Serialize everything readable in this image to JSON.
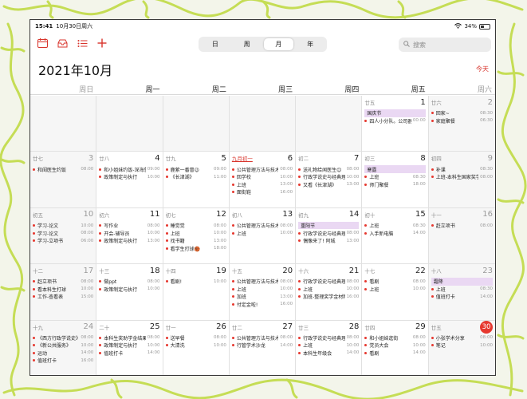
{
  "status": {
    "time": "15:41",
    "date": "10月30日周六",
    "battery": "34%"
  },
  "toolbar": {
    "views": [
      "日",
      "周",
      "月",
      "年"
    ],
    "active_view": "月",
    "search_placeholder": "搜索"
  },
  "title": {
    "year_month": "2021年10月",
    "today": "今天"
  },
  "weekdays": [
    "周日",
    "周一",
    "周二",
    "周三",
    "周四",
    "周五",
    "周六"
  ],
  "colors": {
    "accent": "#e6382f",
    "holiday_bg": "#ead8f3"
  },
  "weeks": [
    [
      {
        "blank": true,
        "lunar": "",
        "day": "",
        "events": []
      },
      {
        "blank": true,
        "lunar": "",
        "day": "",
        "events": []
      },
      {
        "blank": true,
        "lunar": "",
        "day": "",
        "events": []
      },
      {
        "blank": true,
        "lunar": "",
        "day": "",
        "events": []
      },
      {
        "blank": true,
        "lunar": "",
        "day": "",
        "events": []
      },
      {
        "lunar": "廿五",
        "day": "1",
        "events": [
          {
            "title": "国庆节",
            "holiday": true
          },
          {
            "title": "四人小分队。公司器...",
            "time": "00:00"
          }
        ]
      },
      {
        "lunar": "廿六",
        "day": "2",
        "events": [
          {
            "title": "回家~",
            "time": "08:30"
          },
          {
            "title": "家庭聚餐",
            "time": "06:30"
          }
        ]
      }
    ],
    [
      {
        "lunar": "廿七",
        "day": "3",
        "events": [
          {
            "title": "和闺医生约饭",
            "time": "08:00"
          }
        ]
      },
      {
        "lunar": "廿八",
        "day": "4",
        "events": [
          {
            "title": "和小姐妹约饭-深海鲁...",
            "time": "09:00"
          },
          {
            "title": "政策制定与执行",
            "time": "10:00"
          }
        ]
      },
      {
        "lunar": "廿九",
        "day": "5",
        "events": [
          {
            "title": "鹿萦一番冒😉",
            "time": "09:00"
          },
          {
            "title": "《长津湖》",
            "time": "11:00"
          }
        ]
      },
      {
        "lunar": "九月初一",
        "lunar_red": true,
        "day": "6",
        "events": [
          {
            "title": "公共管理方法与技术",
            "time": "08:00"
          },
          {
            "title": "回学校",
            "time": "10:00"
          },
          {
            "title": "上班",
            "time": "13:00"
          },
          {
            "title": "面街鞋",
            "time": "16:00"
          }
        ]
      },
      {
        "lunar": "初二",
        "day": "7",
        "events": [
          {
            "title": "送礼物给闻医生😊",
            "time": "08:00"
          },
          {
            "title": "行政学说史与经典理论",
            "time": "10:00"
          },
          {
            "title": "又看《长津湖》",
            "time": "13:00"
          }
        ]
      },
      {
        "lunar": "初三",
        "day": "8",
        "events": [
          {
            "title": "寒露",
            "holiday": true
          },
          {
            "title": "上班",
            "time": "08:30"
          },
          {
            "title": "师门聚餐",
            "time": "18:00"
          }
        ]
      },
      {
        "lunar": "初四",
        "day": "9",
        "events": [
          {
            "title": "补课",
            "time": "08:30"
          },
          {
            "title": "上班-本科生国家奖学...",
            "time": "08:00"
          }
        ]
      }
    ],
    [
      {
        "lunar": "初五",
        "day": "10",
        "events": [
          {
            "title": "学习-论文",
            "time": "10:00"
          },
          {
            "title": "学习-论文",
            "time": "08:00"
          },
          {
            "title": "学习-立项书",
            "time": "06:00"
          }
        ]
      },
      {
        "lunar": "初六",
        "day": "11",
        "events": [
          {
            "title": "写作业",
            "time": "08:00"
          },
          {
            "title": "开会-辅导员",
            "time": "10:00"
          },
          {
            "title": "政策制定与执行",
            "time": "13:00"
          }
        ]
      },
      {
        "lunar": "初七",
        "day": "12",
        "events": [
          {
            "title": "睡觉觉",
            "time": "08:00"
          },
          {
            "title": "上班",
            "time": "10:00"
          },
          {
            "title": "找书籍",
            "time": "13:00"
          },
          {
            "title": "看学生打球🏀",
            "time": "18:00"
          }
        ]
      },
      {
        "lunar": "初八",
        "day": "13",
        "events": [
          {
            "title": "公共管理方法与技术",
            "time": "08:00"
          },
          {
            "title": "上班",
            "time": "10:00"
          }
        ]
      },
      {
        "lunar": "初九",
        "day": "14",
        "events": [
          {
            "title": "重阳节",
            "holiday": true
          },
          {
            "title": "行政学说史与经典理论",
            "time": "08:00"
          },
          {
            "title": "偶像来了! 阿城",
            "time": "13:00"
          }
        ]
      },
      {
        "lunar": "初十",
        "day": "15",
        "events": [
          {
            "title": "上班",
            "time": "08:30"
          },
          {
            "title": "入手新电脑",
            "time": "14:00"
          }
        ]
      },
      {
        "lunar": "十一",
        "day": "16",
        "events": [
          {
            "title": "赶立项书",
            "time": "08:00"
          }
        ]
      }
    ],
    [
      {
        "lunar": "十二",
        "day": "17",
        "events": [
          {
            "title": "赶立项书",
            "time": "08:00"
          },
          {
            "title": "看本科生打球",
            "time": "10:00"
          },
          {
            "title": "工作-查看表",
            "time": "15:00"
          }
        ]
      },
      {
        "lunar": "十三",
        "day": "18",
        "events": [
          {
            "title": "做ppt",
            "time": "08:00"
          },
          {
            "title": "政策制定与执行",
            "time": "10:00"
          }
        ]
      },
      {
        "lunar": "十四",
        "day": "19",
        "events": [
          {
            "title": "看剧!",
            "time": "10:00"
          }
        ]
      },
      {
        "lunar": "十五",
        "day": "20",
        "events": [
          {
            "title": "公共管理方法与技术",
            "time": "08:00"
          },
          {
            "title": "上班",
            "time": "10:00"
          },
          {
            "title": "加班",
            "time": "13:00"
          },
          {
            "title": "付定金啦!",
            "time": "16:00"
          }
        ]
      },
      {
        "lunar": "十六",
        "day": "21",
        "events": [
          {
            "title": "行政学说史与经典理论",
            "time": "08:00"
          },
          {
            "title": "上班",
            "time": "10:00"
          },
          {
            "title": "加班-整理奖学金材料",
            "time": "16:00"
          }
        ]
      },
      {
        "lunar": "十七",
        "day": "22",
        "events": [
          {
            "title": "看剧",
            "time": "08:00"
          },
          {
            "title": "上班",
            "time": "10:00"
          }
        ]
      },
      {
        "lunar": "十八",
        "day": "23",
        "events": [
          {
            "title": "霜降",
            "holiday": true
          },
          {
            "title": "上班",
            "time": "08:30"
          },
          {
            "title": "值班打卡",
            "time": "14:00"
          }
        ]
      }
    ],
    [
      {
        "lunar": "十九",
        "day": "24",
        "events": [
          {
            "title": "《西方行政学说史》",
            "time": "08:00"
          },
          {
            "title": "《新公共服务》",
            "time": "10:00"
          },
          {
            "title": "运动",
            "time": "14:00"
          },
          {
            "title": "值班打卡",
            "time": "16:00"
          }
        ]
      },
      {
        "lunar": "二十",
        "day": "25",
        "events": [
          {
            "title": "本科生奖助学金结果...",
            "time": "08:00"
          },
          {
            "title": "政策制定与执行",
            "time": "10:00"
          },
          {
            "title": "值班打卡",
            "time": "14:00"
          }
        ]
      },
      {
        "lunar": "廿一",
        "day": "26",
        "events": [
          {
            "title": "送早餐",
            "time": "08:00"
          },
          {
            "title": "大清洗",
            "time": "10:00"
          }
        ]
      },
      {
        "lunar": "廿二",
        "day": "27",
        "events": [
          {
            "title": "公共管理方法与技术",
            "time": "08:00"
          },
          {
            "title": "行管学术沙龙",
            "time": "14:00"
          }
        ]
      },
      {
        "lunar": "廿三",
        "day": "28",
        "events": [
          {
            "title": "行政学说史与经典理论",
            "time": "08:00"
          },
          {
            "title": "上班",
            "time": "10:00"
          },
          {
            "title": "本科生年级会",
            "time": "14:00"
          }
        ]
      },
      {
        "lunar": "廿四",
        "day": "29",
        "events": [
          {
            "title": "和小姐妹逛街",
            "time": "08:00"
          },
          {
            "title": "党员大会",
            "time": "10:00"
          },
          {
            "title": "看剧",
            "time": "14:00"
          }
        ]
      },
      {
        "lunar": "廿五",
        "day": "30",
        "today": true,
        "events": [
          {
            "title": "小张学术分享",
            "time": "08:00"
          },
          {
            "title": "笔记",
            "time": "10:00"
          }
        ]
      }
    ]
  ]
}
